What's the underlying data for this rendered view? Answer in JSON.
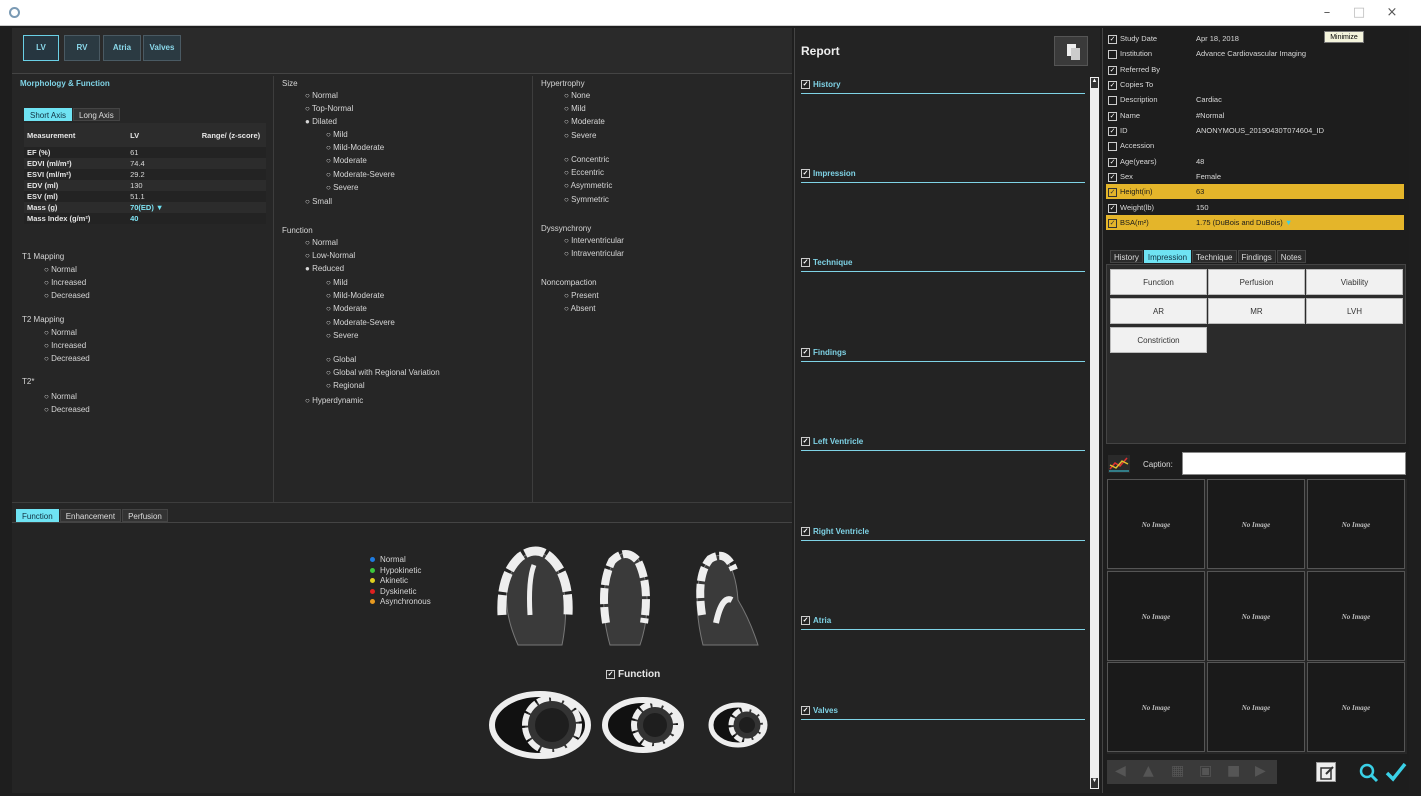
{
  "window": {
    "minimize_tooltip": "Minimize"
  },
  "top_tabs": [
    "LV",
    "RV",
    "Atria",
    "Valves"
  ],
  "morph": {
    "title": "Morphology & Function",
    "sub_tabs": [
      "Short Axis",
      "Long Axis"
    ],
    "table": {
      "headers": [
        "Measurement",
        "LV",
        "Range/ (z-score)"
      ],
      "rows": [
        [
          "EF (%)",
          "61",
          ""
        ],
        [
          "EDVI (ml/m²)",
          "74.4",
          ""
        ],
        [
          "ESVI (ml/m²)",
          "29.2",
          ""
        ],
        [
          "EDV (ml)",
          "130",
          ""
        ],
        [
          "ESV (ml)",
          "51.1",
          ""
        ],
        [
          "Mass (g)",
          "70(ED)",
          ""
        ],
        [
          "Mass Index (g/m²)",
          "40",
          ""
        ]
      ]
    },
    "t1": {
      "label": "T1 Mapping",
      "opts": [
        "Normal",
        "Increased",
        "Decreased"
      ]
    },
    "t2": {
      "label": "T2 Mapping",
      "opts": [
        "Normal",
        "Increased",
        "Decreased"
      ]
    },
    "t2s": {
      "label": "T2*",
      "opts": [
        "Normal",
        "Decreased"
      ]
    }
  },
  "col2": {
    "size_label": "Size",
    "size": [
      "Normal",
      "Top-Normal",
      "Dilated"
    ],
    "size_sub": [
      "Mild",
      "Mild-Moderate",
      "Moderate",
      "Moderate-Severe",
      "Severe"
    ],
    "size_small": "Small",
    "func_label": "Function",
    "func": [
      "Normal",
      "Low-Normal",
      "Reduced"
    ],
    "func_sub": [
      "Mild",
      "Mild-Moderate",
      "Moderate",
      "Moderate-Severe",
      "Severe"
    ],
    "func_sub2": [
      "Global",
      "Global with Regional Variation",
      "Regional"
    ],
    "func_hyper": "Hyperdynamic"
  },
  "col3": {
    "hyp_label": "Hypertrophy",
    "hyp": [
      "None",
      "Mild",
      "Moderate",
      "Severe"
    ],
    "hyp2": [
      "Concentric",
      "Eccentric",
      "Asymmetric",
      "Symmetric"
    ],
    "dys_label": "Dyssynchrony",
    "dys": [
      "Interventricular",
      "Intraventricular"
    ],
    "non_label": "Noncompaction",
    "non": [
      "Present",
      "Absent"
    ]
  },
  "bottom": {
    "tabs": [
      "Function",
      "Enhancement",
      "Perfusion"
    ],
    "legend": [
      {
        "label": "Normal",
        "color": "#1e7be0"
      },
      {
        "label": "Hypokinetic",
        "color": "#3cc83c"
      },
      {
        "label": "Akinetic",
        "color": "#e0d020"
      },
      {
        "label": "Dyskinetic",
        "color": "#e02020"
      },
      {
        "label": "Asynchronous",
        "color": "#e89a20"
      }
    ],
    "function_label": "Function"
  },
  "report": {
    "title": "Report",
    "sections": [
      "History",
      "Impression",
      "Technique",
      "Findings",
      "Left Ventricle",
      "Right Ventricle",
      "Atria",
      "Valves"
    ]
  },
  "patient": [
    {
      "k": "Study Date",
      "v": "Apr 18, 2018",
      "c": true,
      "hl": false
    },
    {
      "k": "Institution",
      "v": "Advance Cardiovascular Imaging",
      "c": false,
      "hl": false
    },
    {
      "k": "Referred By",
      "v": "",
      "c": true,
      "hl": false
    },
    {
      "k": "Copies To",
      "v": "",
      "c": true,
      "hl": false
    },
    {
      "k": "Description",
      "v": "Cardiac",
      "c": false,
      "hl": false
    },
    {
      "k": "Name",
      "v": "#Normal",
      "c": true,
      "hl": false
    },
    {
      "k": "ID",
      "v": "ANONYMOUS_20190430T074604_ID",
      "c": true,
      "hl": false
    },
    {
      "k": "Accession",
      "v": "",
      "c": false,
      "hl": false
    },
    {
      "k": "Age(years)",
      "v": "48",
      "c": true,
      "hl": false
    },
    {
      "k": "Sex",
      "v": "Female",
      "c": true,
      "hl": false
    },
    {
      "k": "Height(in)",
      "v": "63",
      "c": true,
      "hl": true
    },
    {
      "k": "Weight(lb)",
      "v": "150",
      "c": true,
      "hl": false
    },
    {
      "k": "BSA(m²)",
      "v": "1.75 (DuBois and DuBois)",
      "c": true,
      "hl": true
    }
  ],
  "right_tabs": [
    "History",
    "Impression",
    "Technique",
    "Findings",
    "Notes"
  ],
  "impression_buttons": [
    "Function",
    "Perfusion",
    "Viability",
    "AR",
    "MR",
    "LVH",
    "Constriction"
  ],
  "caption_label": "Caption:",
  "no_image": "No Image"
}
